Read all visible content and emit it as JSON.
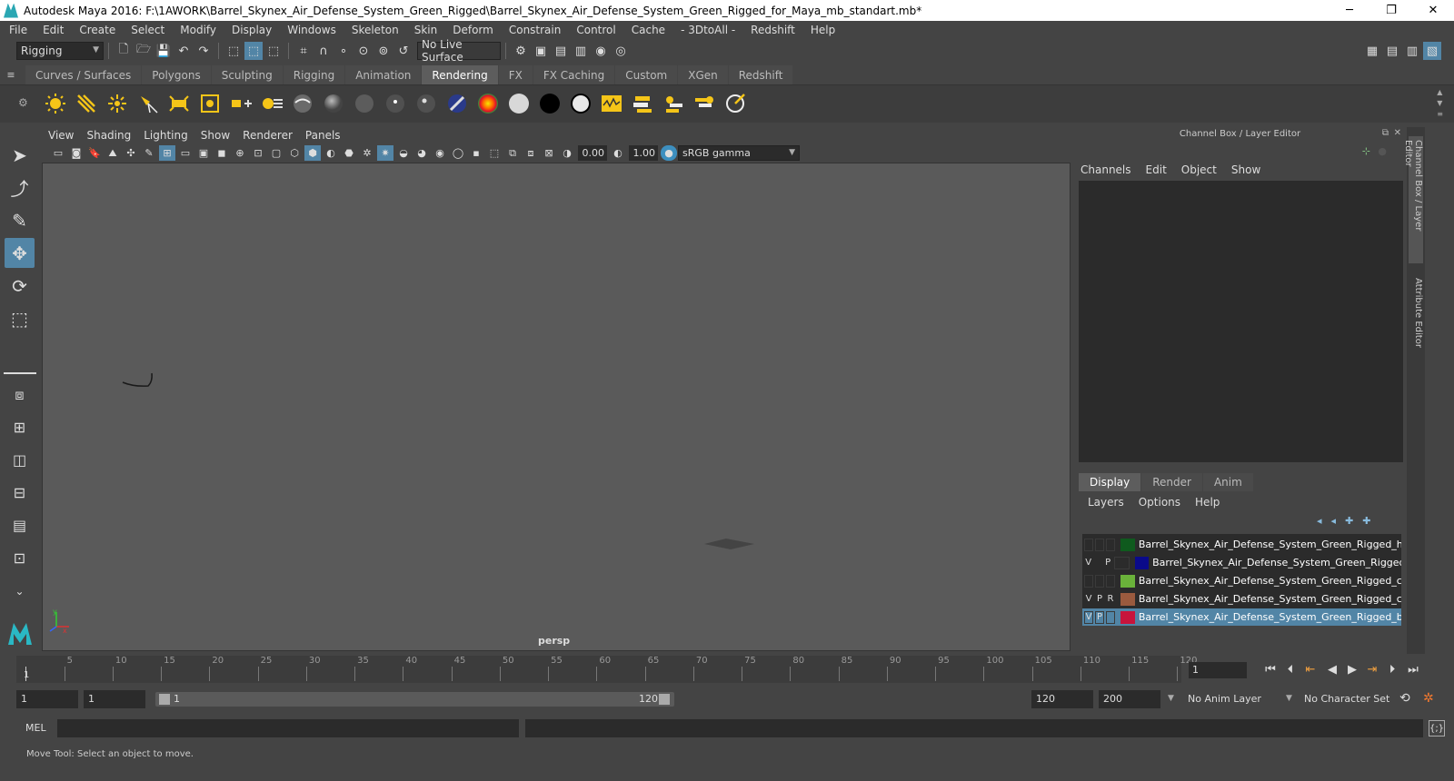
{
  "window": {
    "title": "Autodesk Maya 2016: F:\\1AWORK\\Barrel_Skynex_Air_Defense_System_Green_Rigged\\Barrel_Skynex_Air_Defense_System_Green_Rigged_for_Maya_mb_standart.mb*",
    "minimize": "─",
    "restore": "❐",
    "close": "✕"
  },
  "menubar": [
    "File",
    "Edit",
    "Create",
    "Select",
    "Modify",
    "Display",
    "Windows",
    "Skeleton",
    "Skin",
    "Deform",
    "Constrain",
    "Control",
    "Cache",
    "- 3DtoAll -",
    "Redshift",
    "Help"
  ],
  "statusline": {
    "menuset": "Rigging",
    "live_surface": "No Live Surface"
  },
  "shelf_tabs": [
    {
      "label": "Curves / Surfaces",
      "active": false
    },
    {
      "label": "Polygons",
      "active": false
    },
    {
      "label": "Sculpting",
      "active": false
    },
    {
      "label": "Rigging",
      "active": false
    },
    {
      "label": "Animation",
      "active": false
    },
    {
      "label": "Rendering",
      "active": true
    },
    {
      "label": "FX",
      "active": false
    },
    {
      "label": "FX Caching",
      "active": false
    },
    {
      "label": "Custom",
      "active": false
    },
    {
      "label": "XGen",
      "active": false
    },
    {
      "label": "Redshift",
      "active": false
    }
  ],
  "viewport": {
    "menu": [
      "View",
      "Shading",
      "Lighting",
      "Show",
      "Renderer",
      "Panels"
    ],
    "exposure": "0.00",
    "gamma": "1.00",
    "colorspace": "sRGB gamma",
    "camera": "persp"
  },
  "channel_box": {
    "header": "Channel Box / Layer Editor",
    "menu": [
      "Channels",
      "Edit",
      "Object",
      "Show"
    ]
  },
  "layer_editor": {
    "tabs": [
      {
        "label": "Display",
        "active": true
      },
      {
        "label": "Render",
        "active": false
      },
      {
        "label": "Anim",
        "active": false
      }
    ],
    "menu": [
      "Layers",
      "Options",
      "Help"
    ],
    "layers": [
      {
        "v": "",
        "p": "",
        "r": "",
        "color": "#0f5a1e",
        "name": "Barrel_Skynex_Air_Defense_System_Green_Rigged_helper",
        "selected": false
      },
      {
        "v": "V",
        "p": "P",
        "r": "",
        "color": "#0a0a8a",
        "name": "Barrel_Skynex_Air_Defense_System_Green_Rigged",
        "selected": false
      },
      {
        "v": "",
        "p": "",
        "r": "",
        "color": "#6ab23a",
        "name": "Barrel_Skynex_Air_Defense_System_Green_Rigged_contro",
        "selected": false
      },
      {
        "v": "V",
        "p": "P",
        "r": "R",
        "color": "#9a5a3e",
        "name": "Barrel_Skynex_Air_Defense_System_Green_Rigged_contro",
        "selected": false
      },
      {
        "v": "V",
        "p": "P",
        "r": "",
        "color": "#c8143c",
        "name": "Barrel_Skynex_Air_Defense_System_Green_Rigged_bones",
        "selected": true
      }
    ]
  },
  "side_tabs": [
    "Channel Box / Layer Editor",
    "Attribute Editor"
  ],
  "timeline": {
    "ticks": [
      "5",
      "10",
      "15",
      "20",
      "25",
      "30",
      "35",
      "40",
      "45",
      "50",
      "55",
      "60",
      "65",
      "70",
      "75",
      "80",
      "85",
      "90",
      "95",
      "100",
      "105",
      "110",
      "115",
      "120"
    ],
    "start_marker": "1",
    "current_frame": "1"
  },
  "range": {
    "start": "1",
    "playback_start": "1",
    "slider_start": "1",
    "slider_end": "120",
    "playback_end": "120",
    "end": "200",
    "anim_layer": "No Anim Layer",
    "character_set": "No Character Set"
  },
  "command_line": {
    "label": "MEL"
  },
  "help_line": "Move Tool: Select an object to move.",
  "colors": {
    "accent": "#5285a6",
    "background": "#444444",
    "viewport": "#5a5a5a"
  }
}
